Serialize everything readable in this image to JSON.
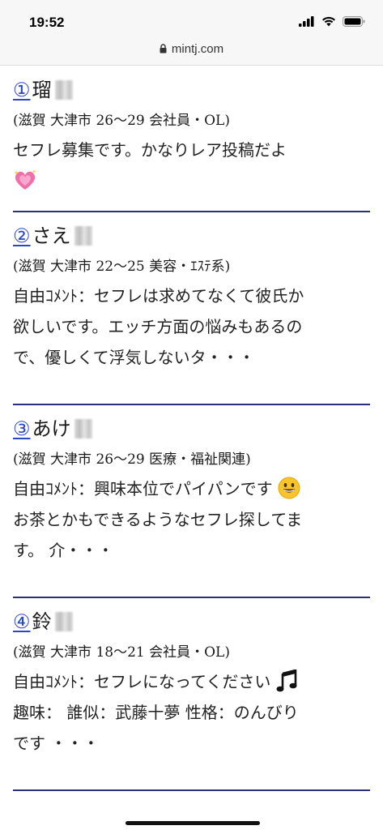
{
  "status_bar": {
    "time": "19:52"
  },
  "browser": {
    "url": "mintj.com"
  },
  "posts": [
    {
      "num": "①",
      "name": "瑠",
      "meta": "(滋賀 大津市 26〜29 会社員・OL)",
      "line1": "セフレ募集です。かなりレア投稿だよ",
      "line2": "",
      "line3": ""
    },
    {
      "num": "②",
      "name": "さえ",
      "meta": "(滋賀 大津市 22〜25 美容・ｴｽﾃ系)",
      "line1": "自由ｺﾒﾝﾄ：セフレは求めてなくて彼氏か",
      "line2": "欲しいです。エッチ方面の悩みもあるの",
      "line3": "で、優しくて浮気しないタ・・・"
    },
    {
      "num": "③",
      "name": "あけ",
      "meta": "(滋賀 大津市 26〜29 医療・福祉関連)",
      "line1": "自由ｺﾒﾝﾄ：興味本位でパイパンです",
      "line2": "お茶とかもできるようなセフレ探してま",
      "line3": "す。 介・・・"
    },
    {
      "num": "④",
      "name": "鈴",
      "meta": "(滋賀 大津市 18〜21 会社員・OL)",
      "line1": "自由ｺﾒﾝﾄ：セフレになってください",
      "line2": "趣味： 誰似：武藤十夢 性格：のんびり",
      "line3": "です ・・・"
    }
  ]
}
